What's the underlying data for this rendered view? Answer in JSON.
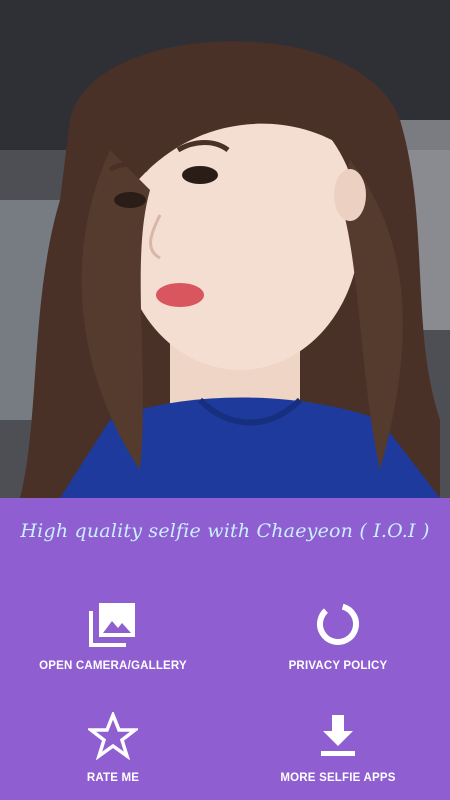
{
  "header": {
    "tagline": "High quality selfie with Chaeyeon ( I.O.I )"
  },
  "actions": [
    {
      "label": "OPEN CAMERA/GALLERY",
      "icon": "gallery-icon"
    },
    {
      "label": "PRIVACY POLICY",
      "icon": "privacy-ring-icon"
    },
    {
      "label": "RATE ME",
      "icon": "star-icon"
    },
    {
      "label": "MORE SELFIE APPS",
      "icon": "download-icon"
    }
  ],
  "colors": {
    "panel": "#8f5fd1",
    "tagline": "#c9f0ff",
    "label": "#ffffff"
  }
}
